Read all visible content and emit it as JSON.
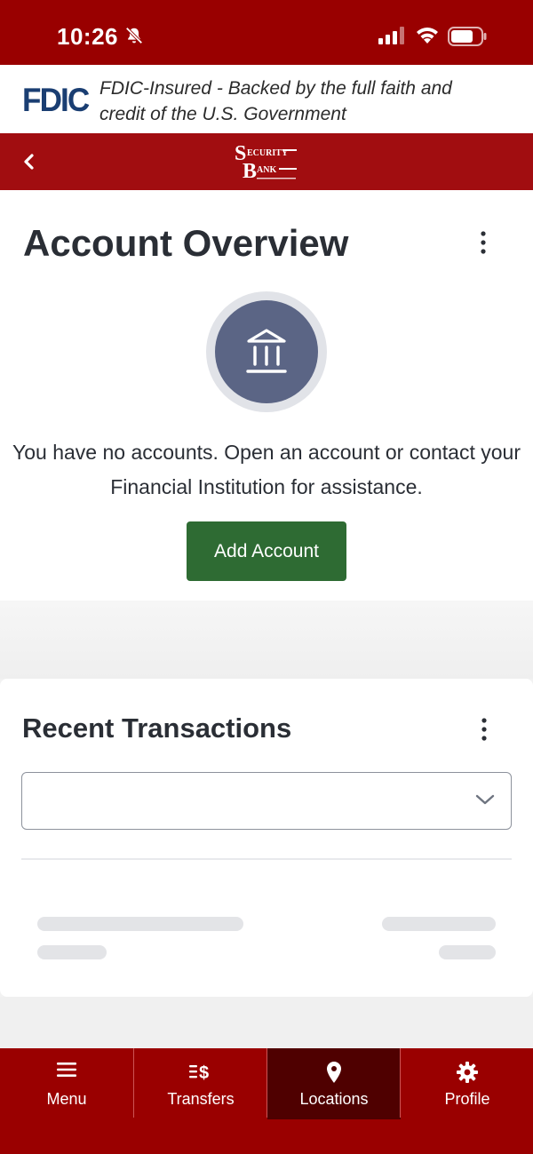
{
  "status_bar": {
    "time": "10:26",
    "icons": [
      "bell-slash-icon",
      "signal-icon",
      "wifi-icon",
      "battery-icon"
    ]
  },
  "banner": {
    "logo_text": "FDIC",
    "text": "FDIC-Insured - Backed by the full faith and credit of the U.S. Government"
  },
  "navbar": {
    "back_icon": "chevron-left-icon",
    "brand_logo_text": "SECURITY BANK"
  },
  "account_overview": {
    "title": "Account Overview",
    "empty_message": "You have no accounts. Open an account or contact your Financial Institution for assistance.",
    "add_button_label": "Add Account",
    "icon": "bank-building-icon"
  },
  "recent_transactions": {
    "title": "Recent Transactions",
    "filter_value": ""
  },
  "tabbar": {
    "tabs": [
      {
        "label": "Menu",
        "icon": "hamburger-icon"
      },
      {
        "label": "Transfers",
        "icon": "transfer-dollar-icon"
      },
      {
        "label": "Locations",
        "icon": "map-pin-icon",
        "active": true
      },
      {
        "label": "Profile",
        "icon": "gear-icon"
      }
    ]
  },
  "colors": {
    "brand_red": "#9a0000",
    "active_tab": "#4f0000",
    "button_green": "#2e6b33",
    "fdic_blue": "#1a3e72"
  }
}
